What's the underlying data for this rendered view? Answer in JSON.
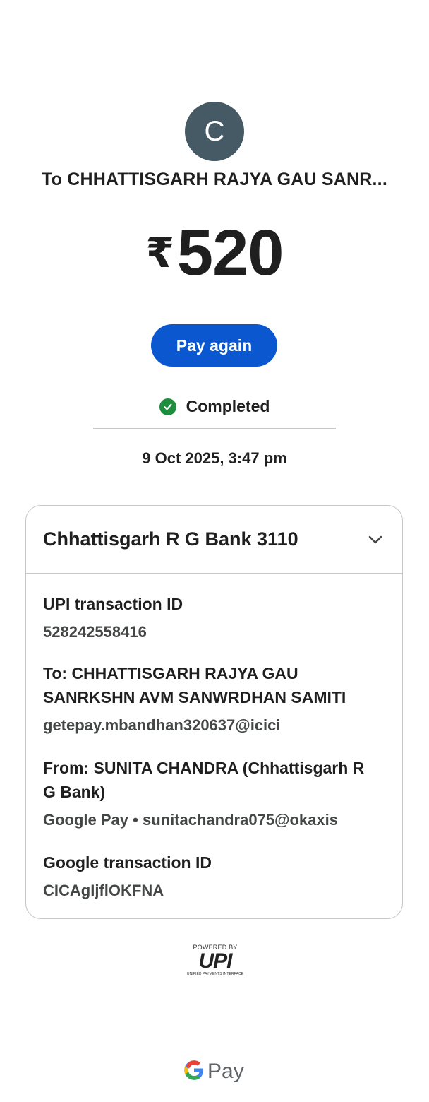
{
  "header": {
    "avatar_initial": "C",
    "recipient": "To CHHATTISGARH RAJYA GAU SANR...",
    "currency_symbol": "₹",
    "amount": "520"
  },
  "actions": {
    "pay_again_label": "Pay again"
  },
  "status": {
    "label": "Completed",
    "icon": "check-circle-icon",
    "color": "#1e8e3e",
    "timestamp": "9 Oct 2025, 3:47 pm"
  },
  "details": {
    "bank_account": "Chhattisgarh R G Bank 3110",
    "upi_txn_title": "UPI transaction ID",
    "upi_txn_id": "528242558416",
    "to_line1": "To: CHHATTISGARH RAJYA GAU",
    "to_line2": "SANRKSHN AVM SANWRDHAN SAMITI",
    "to_vpa": "getepay.mbandhan320637@icici",
    "from_line1": "From: SUNITA CHANDRA (Chhattisgarh R",
    "from_line2": "G Bank)",
    "from_vpa": "Google Pay • sunitachandra075@okaxis",
    "google_txn_title": "Google transaction ID",
    "google_txn_id": "CICAgIjflOKFNA"
  },
  "footer": {
    "powered_by": "POWERED BY",
    "upi_text": "UPI",
    "upi_sub": "UNIFIED PAYMENTS INTERFACE",
    "gpay_text": "Pay"
  },
  "colors": {
    "accent": "#0b57d0",
    "avatar_bg": "#455a64"
  }
}
